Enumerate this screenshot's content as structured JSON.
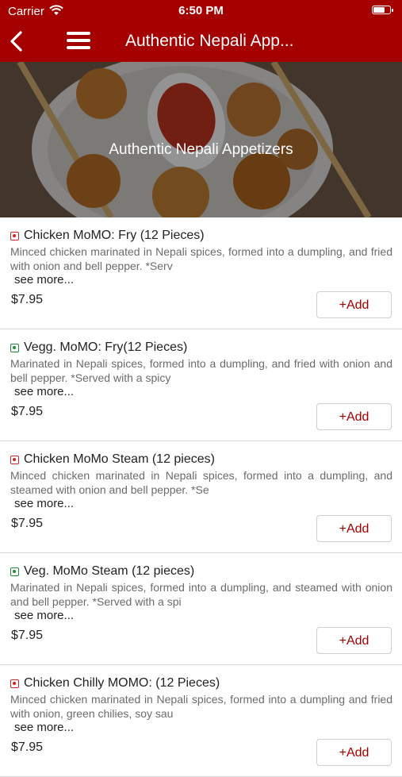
{
  "status_bar": {
    "carrier": "Carrier",
    "time": "6:50 PM"
  },
  "nav": {
    "title": "Authentic Nepali App..."
  },
  "hero": {
    "title": "Authentic Nepali Appetizers"
  },
  "colors": {
    "brand": "#a50000",
    "veg": "#1f8a3b",
    "nonveg": "#c62828"
  },
  "items": [
    {
      "name": "Chicken MoMO: Fry (12 Pieces)",
      "type": "non-veg",
      "desc": "Minced chicken marinated in Nepali spices, formed into a dumpling, and fried with onion and bell pepper. *Serv",
      "see_more": "see more...",
      "price": "$7.95",
      "add": "+Add"
    },
    {
      "name": "Vegg. MoMO: Fry(12 Pieces)",
      "type": "veg",
      "desc": "Marinated in Nepali spices, formed into a dumpling, and fried with onion and bell pepper. *Served with a spicy",
      "see_more": "see more...",
      "price": "$7.95",
      "add": "+Add"
    },
    {
      "name": "Chicken MoMo Steam (12 pieces)",
      "type": "non-veg",
      "desc": "Minced chicken marinated in Nepali spices, formed into a dumpling, and steamed with onion and bell pepper. *Se",
      "see_more": "see more...",
      "price": "$7.95",
      "add": "+Add"
    },
    {
      "name": "Veg. MoMo Steam (12 pieces)",
      "type": "veg",
      "desc": "Marinated in Nepali spices, formed into a dumpling, and steamed with onion and bell pepper. *Served with a spi",
      "see_more": "see more...",
      "price": "$7.95",
      "add": "+Add"
    },
    {
      "name": "Chicken Chilly MOMO: (12 Pieces)",
      "type": "non-veg",
      "desc": "Minced chicken marinated in Nepali spices, formed into a dumpling and fried with onion, green chilies, soy sau",
      "see_more": "see more...",
      "price": "$7.95",
      "add": "+Add"
    }
  ]
}
